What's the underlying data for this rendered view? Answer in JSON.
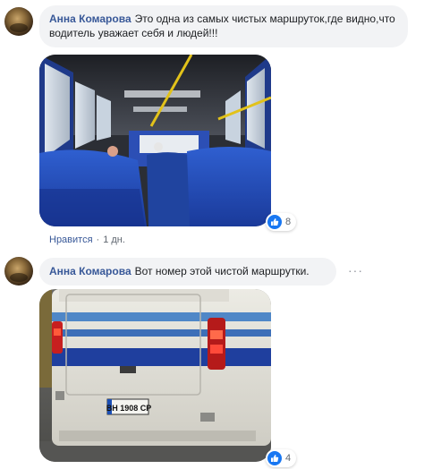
{
  "comments": [
    {
      "author": "Анна Комарова",
      "text": "Это одна из самых чистых маршруток,где видно,что водитель уважает себя и людей!!!",
      "attachment": "bus-interior-photo",
      "reaction_icon": "thumbs-up-icon",
      "reaction_count": "8",
      "like_label": "Нравится",
      "time": "1 дн."
    },
    {
      "author": "Анна Комарова",
      "text": "Вот номер этой чистой маршрутки.",
      "attachment": "bus-rear-photo",
      "license_plate": "ВН 1908 СР",
      "reaction_icon": "thumbs-up-icon",
      "reaction_count": "4",
      "more_icon": "more-options-icon"
    }
  ],
  "colors": {
    "author_link": "#385898",
    "bubble_bg": "#f2f3f5",
    "like_blue": "#1877f2",
    "meta_gray": "#606770"
  }
}
